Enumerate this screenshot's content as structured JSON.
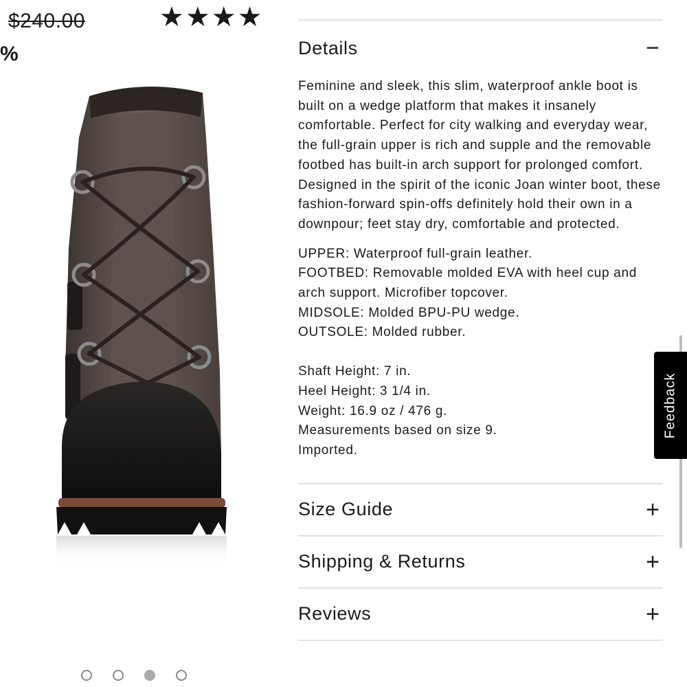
{
  "product": {
    "old_price": "$240.00",
    "rating_stars": "★★★★",
    "discount_fragment": "%",
    "image_icon": "ankle-wedge-boot"
  },
  "carousel": {
    "count": 4,
    "active_index": 2
  },
  "details": {
    "title": "Details",
    "toggle": "−",
    "description": "Feminine and sleek, this slim, waterproof ankle boot is built on a wedge platform that makes it insanely comfortable. Perfect for city walking and everyday wear, the full-grain upper is rich and supple and the removable footbed has built-in arch support for prolonged comfort. Designed in the spirit of the iconic Joan winter boot, these fashion-forward spin-offs definitely hold their own in a downpour; feet stay dry, comfortable and protected.",
    "specs": [
      "UPPER: Waterproof full-grain leather.",
      "FOOTBED: Removable molded EVA with heel cup and arch support. Microfiber topcover.",
      "MIDSOLE: Molded BPU-PU wedge.",
      "OUTSOLE: Molded rubber."
    ],
    "dimensions": [
      "Shaft Height: 7 in.",
      "Heel Height: 3 1/4 in.",
      "Weight: 16.9 oz / 476 g.",
      "Measurements based on size 9.",
      "Imported."
    ]
  },
  "accordion": [
    {
      "title": "Size Guide",
      "toggle": "+"
    },
    {
      "title": "Shipping & Returns",
      "toggle": "+"
    },
    {
      "title": "Reviews",
      "toggle": "+"
    }
  ],
  "feedback": {
    "label": "Feedback"
  },
  "colors": {
    "accent": "#000000",
    "divider": "#e1e1e1",
    "dot": "#888888"
  }
}
